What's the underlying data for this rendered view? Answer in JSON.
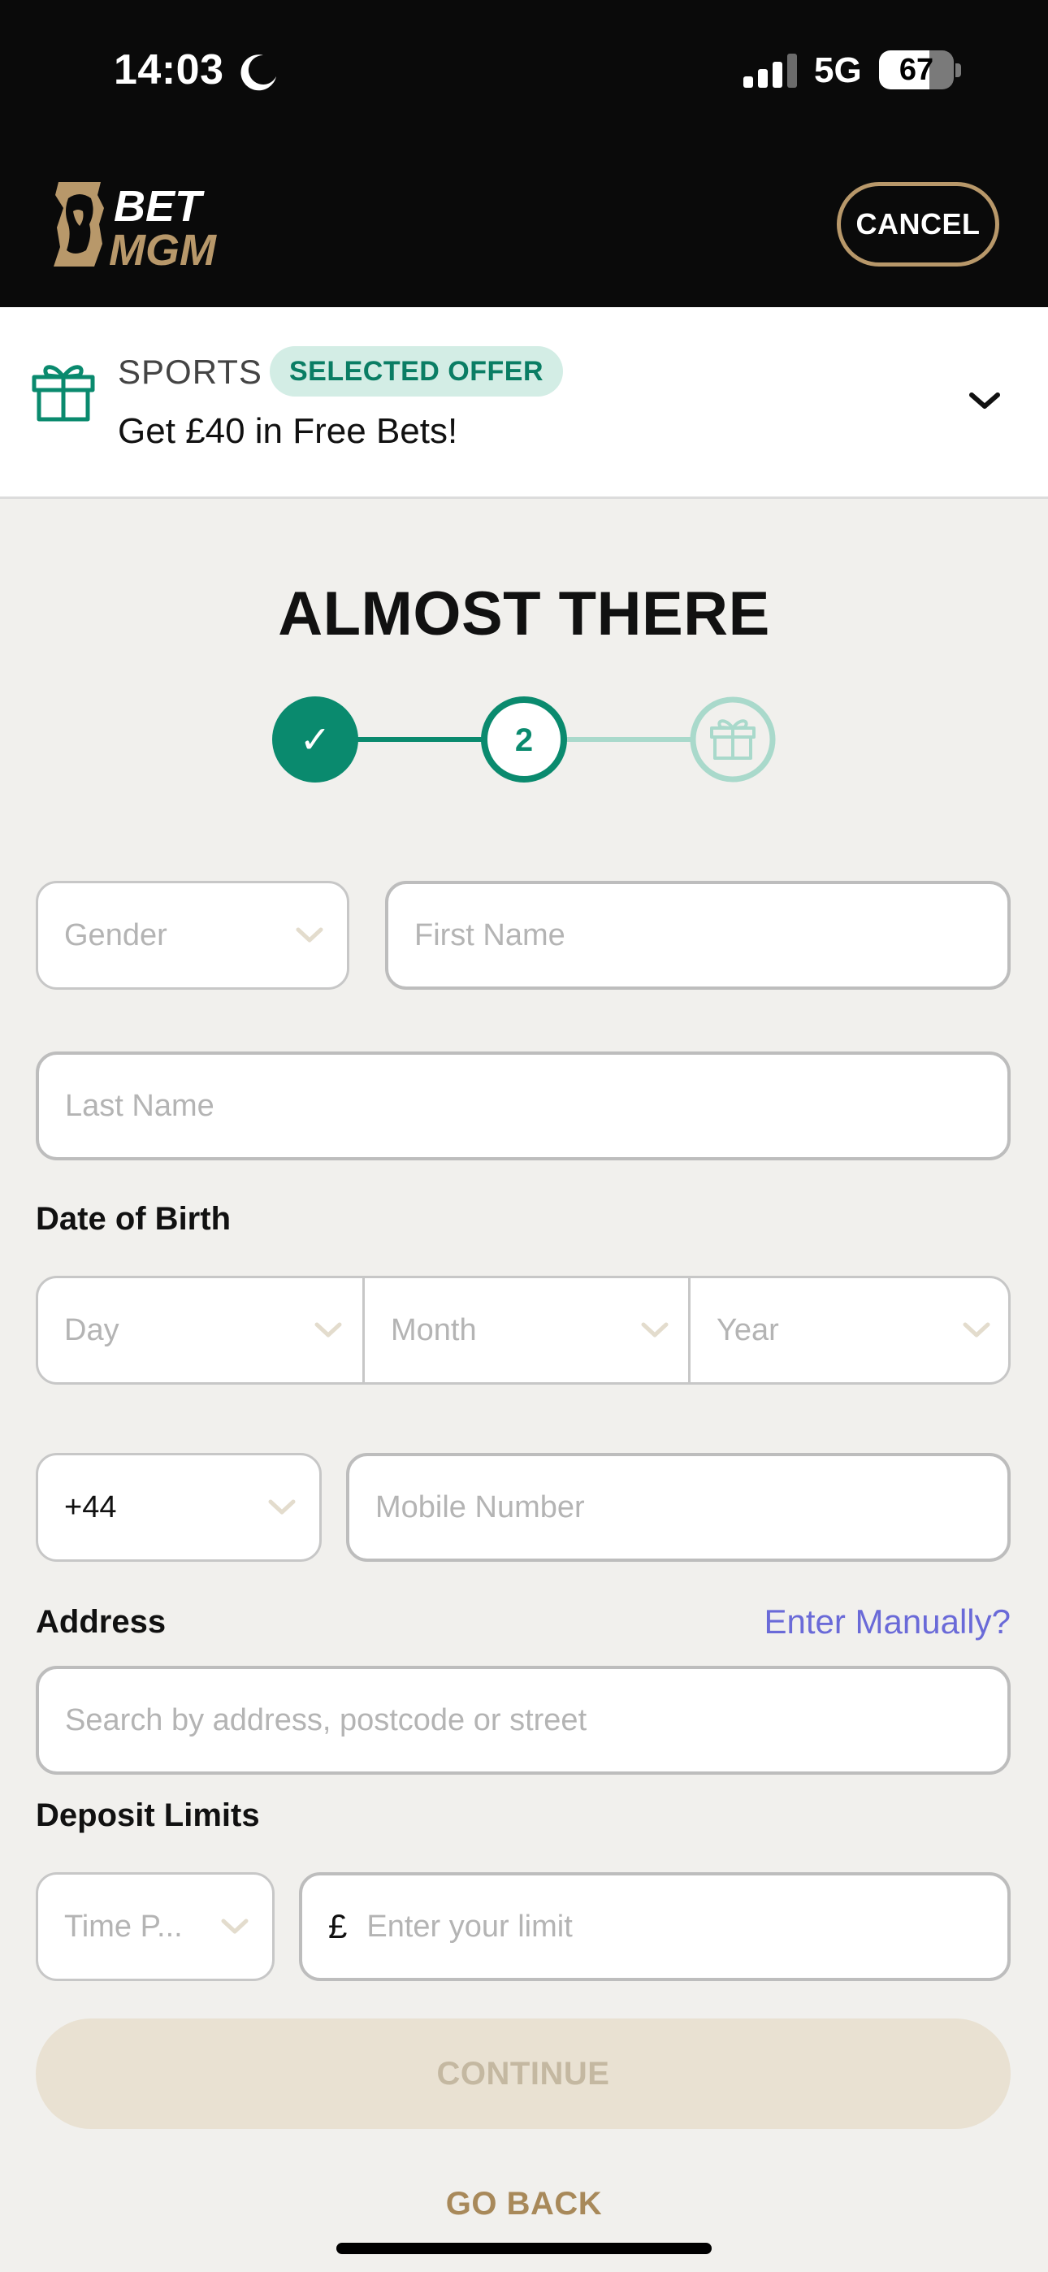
{
  "status_bar": {
    "time": "14:03",
    "network": "5G",
    "battery_level": "67",
    "battery_fraction": 0.67
  },
  "header": {
    "logo_alt": "BET MGM",
    "cancel_label": "CANCEL"
  },
  "offer": {
    "category": "SPORTS",
    "badge": "SELECTED OFFER",
    "text": "Get £40 in Free Bets!"
  },
  "title": "ALMOST THERE",
  "stepper": {
    "steps": [
      {
        "state": "complete",
        "label": "✓"
      },
      {
        "state": "current",
        "label": "2"
      },
      {
        "state": "upcoming",
        "label": ""
      }
    ]
  },
  "form": {
    "gender_placeholder": "Gender",
    "first_name_placeholder": "First Name",
    "last_name_placeholder": "Last Name",
    "dob_label": "Date of Birth",
    "dob_day": "Day",
    "dob_month": "Month",
    "dob_year": "Year",
    "country_code": "+44",
    "mobile_placeholder": "Mobile Number",
    "address_label": "Address",
    "enter_manually": "Enter Manually?",
    "address_placeholder": "Search by address, postcode or street",
    "deposit_label": "Deposit Limits",
    "time_period_placeholder": "Time P...",
    "currency_symbol": "£",
    "limit_placeholder": "Enter your limit"
  },
  "actions": {
    "continue_label": "CONTINUE",
    "go_back_label": "GO BACK"
  },
  "colors": {
    "brand_gold": "#b8986a",
    "accent_green": "#0a8a6e",
    "link_purple": "#6a6ad8",
    "background": "#f1f0ed"
  }
}
